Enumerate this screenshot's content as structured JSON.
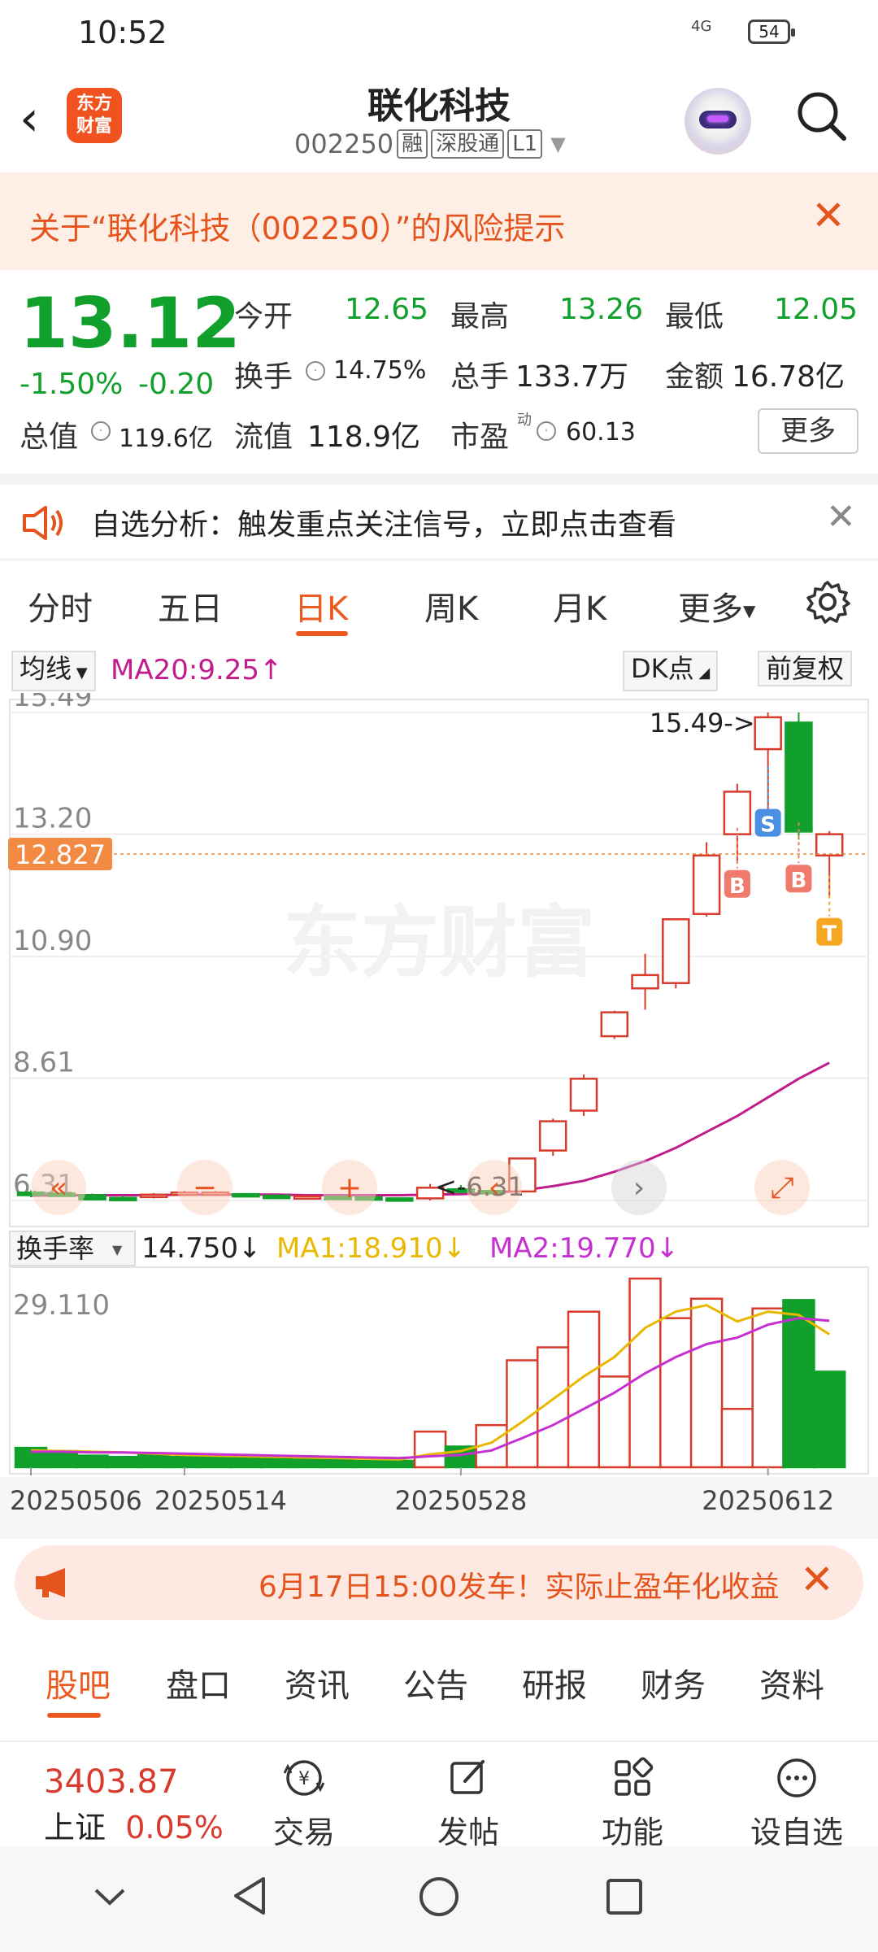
{
  "status": {
    "time": "10:52",
    "signal": "4G",
    "battery": "54"
  },
  "header": {
    "logo_line1": "东方",
    "logo_line2": "财富",
    "title": "联化科技",
    "code": "002250",
    "tags": [
      "融",
      "深股通",
      "L1"
    ]
  },
  "risk_banner": {
    "text": "关于“联化科技（002250）”的风险提示"
  },
  "quote": {
    "price": "13.12",
    "change_pct": "-1.50%",
    "change": "-0.20",
    "open_label": "今开",
    "open": "12.65",
    "high_label": "最高",
    "high": "13.26",
    "low_label": "最低",
    "low": "12.05",
    "turnover_label": "换手",
    "turnover": "14.75%",
    "volume_label": "总手",
    "volume": "133.7万",
    "amount_label": "金额",
    "amount": "16.78亿",
    "mktcap_label": "总值",
    "mktcap": "119.6亿",
    "float_label": "流值",
    "float": "118.9亿",
    "pe_label": "市盈",
    "pe_sup": "动",
    "pe": "60.13",
    "more": "更多"
  },
  "alert": {
    "text": "自选分析：触发重点关注信号，立即点击查看"
  },
  "ktabs": [
    "分时",
    "五日",
    "日K",
    "周K",
    "月K",
    "更多"
  ],
  "ktab_active": "日K",
  "chart_header": {
    "ma_select": "均线",
    "ma20": "MA20:9.25↑",
    "dk": "DK点",
    "fq": "前复权"
  },
  "chart_data": [
    {
      "type": "candlestick",
      "y_ticks": [
        "15.49",
        "13.20",
        "10.90",
        "8.61",
        "6.31"
      ],
      "ylim": [
        6.31,
        15.49
      ],
      "current_price_label": "12.827",
      "max_annotation": "15.49->",
      "min_annotation": "<-6.31",
      "watermark": "东方财富",
      "signals": [
        "S",
        "B",
        "B",
        "T"
      ],
      "candles": [
        {
          "o": 6.46,
          "c": 6.41,
          "h": 6.5,
          "l": 6.37
        },
        {
          "o": 6.44,
          "c": 6.42,
          "h": 6.48,
          "l": 6.38
        },
        {
          "o": 6.41,
          "c": 6.33,
          "h": 6.44,
          "l": 6.31
        },
        {
          "o": 6.36,
          "c": 6.34,
          "h": 6.4,
          "l": 6.32
        },
        {
          "o": 6.38,
          "c": 6.42,
          "h": 6.45,
          "l": 6.35
        },
        {
          "o": 6.44,
          "c": 6.46,
          "h": 6.49,
          "l": 6.41
        },
        {
          "o": 6.44,
          "c": 6.46,
          "h": 6.49,
          "l": 6.41
        },
        {
          "o": 6.43,
          "c": 6.41,
          "h": 6.45,
          "l": 6.38
        },
        {
          "o": 6.4,
          "c": 6.38,
          "h": 6.43,
          "l": 6.35
        },
        {
          "o": 6.38,
          "c": 6.39,
          "h": 6.42,
          "l": 6.36
        },
        {
          "o": 6.38,
          "c": 6.37,
          "h": 6.41,
          "l": 6.35
        },
        {
          "o": 6.37,
          "c": 6.35,
          "h": 6.39,
          "l": 6.32
        },
        {
          "o": 6.35,
          "c": 6.31,
          "h": 6.37,
          "l": 6.3
        },
        {
          "o": 6.35,
          "c": 6.55,
          "h": 6.62,
          "l": 6.31
        },
        {
          "o": 6.52,
          "c": 6.47,
          "h": 6.6,
          "l": 6.44
        },
        {
          "o": 6.49,
          "c": 6.46,
          "h": 6.52,
          "l": 6.43
        },
        {
          "o": 6.48,
          "c": 7.1,
          "h": 7.12,
          "l": 6.46
        },
        {
          "o": 7.25,
          "c": 7.8,
          "h": 7.85,
          "l": 7.15
        },
        {
          "o": 8.0,
          "c": 8.6,
          "h": 8.68,
          "l": 7.9
        },
        {
          "o": 9.4,
          "c": 9.85,
          "h": 9.88,
          "l": 9.35
        },
        {
          "o": 10.3,
          "c": 10.55,
          "h": 10.95,
          "l": 9.9
        },
        {
          "o": 10.4,
          "c": 11.6,
          "h": 11.62,
          "l": 10.3
        },
        {
          "o": 11.7,
          "c": 12.8,
          "h": 13.05,
          "l": 11.65
        },
        {
          "o": 13.2,
          "c": 14.0,
          "h": 14.15,
          "l": 12.65
        },
        {
          "o": 14.8,
          "c": 15.4,
          "h": 15.49,
          "l": 13.45
        },
        {
          "o": 15.3,
          "c": 13.25,
          "h": 15.49,
          "l": 13.1
        },
        {
          "o": 12.8,
          "c": 13.2,
          "h": 13.26,
          "l": 12.05
        }
      ],
      "ma20": [
        6.4,
        6.41,
        6.41,
        6.41,
        6.41,
        6.42,
        6.42,
        6.42,
        6.42,
        6.41,
        6.41,
        6.41,
        6.41,
        6.42,
        6.43,
        6.45,
        6.5,
        6.58,
        6.68,
        6.85,
        7.05,
        7.3,
        7.6,
        7.9,
        8.25,
        8.6,
        8.9
      ]
    },
    {
      "type": "bar",
      "indicator": "换手率",
      "value": "14.750↓",
      "ma1": "MA1:18.910↓",
      "ma2": "MA2:19.770↓",
      "y_ticks": [
        "29.110"
      ],
      "ylim": [
        0,
        29.11
      ],
      "x_ticks": [
        "20250506",
        "20250514",
        "20250528",
        "20250612"
      ],
      "values": [
        3.0,
        2.5,
        1.8,
        1.6,
        2.0,
        1.6,
        1.6,
        1.6,
        1.3,
        1.2,
        1.1,
        1.0,
        1.0,
        5.5,
        3.2,
        6.5,
        16.5,
        18.5,
        24.0,
        14.0,
        29.11,
        23.0,
        26.0,
        9.0,
        24.5,
        25.8,
        14.75
      ],
      "up": [
        false,
        false,
        false,
        false,
        false,
        false,
        false,
        false,
        false,
        false,
        false,
        false,
        false,
        true,
        false,
        true,
        true,
        true,
        true,
        true,
        true,
        true,
        true,
        true,
        true,
        false,
        false
      ],
      "ma1_line": [
        2.6,
        2.5,
        2.4,
        2.3,
        2.1,
        1.9,
        1.8,
        1.7,
        1.6,
        1.5,
        1.4,
        1.3,
        1.2,
        2.0,
        2.5,
        3.8,
        7.0,
        10.5,
        14.0,
        17.0,
        21.5,
        24.0,
        25.0,
        22.5,
        24.0,
        23.5,
        20.5
      ],
      "ma2_line": [
        2.4,
        2.4,
        2.3,
        2.3,
        2.2,
        2.1,
        2.0,
        1.9,
        1.8,
        1.7,
        1.6,
        1.5,
        1.4,
        1.7,
        1.9,
        2.6,
        4.5,
        6.5,
        9.0,
        11.5,
        14.5,
        17.0,
        19.0,
        20.0,
        22.0,
        23.0,
        22.6
      ]
    }
  ],
  "chart_controls": [
    "«",
    "−",
    "+",
    "‹",
    "›",
    "⤢"
  ],
  "promo": {
    "text": "6月17日15:00发车！实际止盈年化收益"
  },
  "bottom_tabs": [
    "股吧",
    "盘口",
    "资讯",
    "公告",
    "研报",
    "财务",
    "资料"
  ],
  "bottom_tab_active": "股吧",
  "dock": {
    "index_value": "3403.87",
    "index_name": "上证",
    "index_change": "0.05%",
    "items": [
      "交易",
      "发帖",
      "功能",
      "设自选"
    ]
  },
  "colors": {
    "up": "#d83a2b",
    "down": "#11a02b",
    "accent": "#ec5a1f",
    "ma20": "#c01c8c",
    "ma1": "#e8b800",
    "ma2": "#c62fd1"
  }
}
